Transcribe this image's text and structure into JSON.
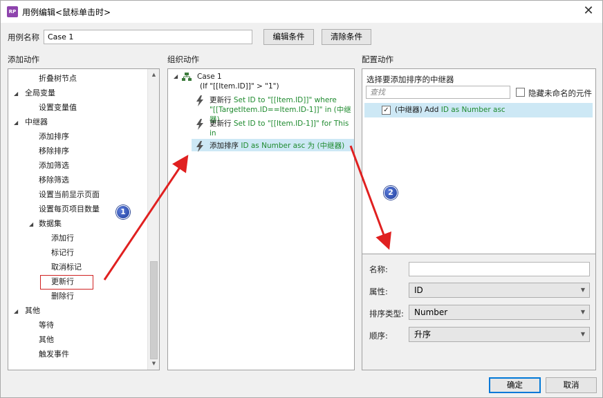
{
  "window": {
    "title": "用例编辑<鼠标单击时>",
    "app_icon": "RP"
  },
  "case_name": {
    "label": "用例名称",
    "value": "Case 1"
  },
  "buttons": {
    "edit_condition": "编辑条件",
    "clear_condition": "清除条件",
    "ok": "确定",
    "cancel": "取消"
  },
  "sections": {
    "add_action": "添加动作",
    "organize_action": "组织动作",
    "configure_action": "配置动作"
  },
  "add_action_tree": [
    {
      "label": "折叠树节点",
      "level": 1,
      "expander": ""
    },
    {
      "label": "全局变量",
      "level": 0,
      "expander": "◢"
    },
    {
      "label": "设置变量值",
      "level": 1,
      "expander": ""
    },
    {
      "label": "中继器",
      "level": 0,
      "expander": "◢"
    },
    {
      "label": "添加排序",
      "level": 1,
      "expander": ""
    },
    {
      "label": "移除排序",
      "level": 1,
      "expander": ""
    },
    {
      "label": "添加筛选",
      "level": 1,
      "expander": ""
    },
    {
      "label": "移除筛选",
      "level": 1,
      "expander": ""
    },
    {
      "label": "设置当前显示页面",
      "level": 1,
      "expander": ""
    },
    {
      "label": "设置每页项目数量",
      "level": 1,
      "expander": ""
    },
    {
      "label": "数据集",
      "level": 1,
      "expander": "◢"
    },
    {
      "label": "添加行",
      "level": 2,
      "expander": ""
    },
    {
      "label": "标记行",
      "level": 2,
      "expander": ""
    },
    {
      "label": "取消标记",
      "level": 2,
      "expander": ""
    },
    {
      "label": "更新行",
      "level": 2,
      "expander": ""
    },
    {
      "label": "删除行",
      "level": 2,
      "expander": ""
    },
    {
      "label": "其他",
      "level": 0,
      "expander": "◢"
    },
    {
      "label": "等待",
      "level": 1,
      "expander": ""
    },
    {
      "label": "其他",
      "level": 1,
      "expander": ""
    },
    {
      "label": "触发事件",
      "level": 1,
      "expander": ""
    }
  ],
  "organize": {
    "case_title": "Case 1",
    "case_condition": "(If \"[[Item.ID]]\" > \"1\")",
    "actions": [
      {
        "prefix": "更新行",
        "line1": "Set ID to \"[[Item.ID]]\" where",
        "line2": "\"[[TargetItem.ID==Item.ID-1]]\" in (中继器)",
        "line3": ""
      },
      {
        "prefix": "更新行",
        "line1": "Set ID to \"[[Item.ID-1]]\" for This in",
        "line2": "(中继器)",
        "line3": ""
      },
      {
        "prefix": "添加排序",
        "line1": "ID as Number asc 为 (中继器)",
        "line2": "",
        "line3": ""
      }
    ]
  },
  "configure": {
    "select_title": "选择要添加排序的中继器",
    "search_placeholder": "查找",
    "hide_unnamed_label": "隐藏未命名的元件",
    "repeater_item": {
      "name": "(中继器)",
      "prefix": "Add",
      "desc": "ID as Number asc",
      "checked": true
    },
    "fields": {
      "name_label": "名称:",
      "name_value": "",
      "property_label": "属性:",
      "property_value": "ID",
      "sort_type_label": "排序类型:",
      "sort_type_value": "Number",
      "order_label": "顺序:",
      "order_value": "升序"
    }
  },
  "annotations": {
    "badge1": "1",
    "badge2": "2",
    "accent_color": "#e02020",
    "badge_color": "#2747a8"
  }
}
